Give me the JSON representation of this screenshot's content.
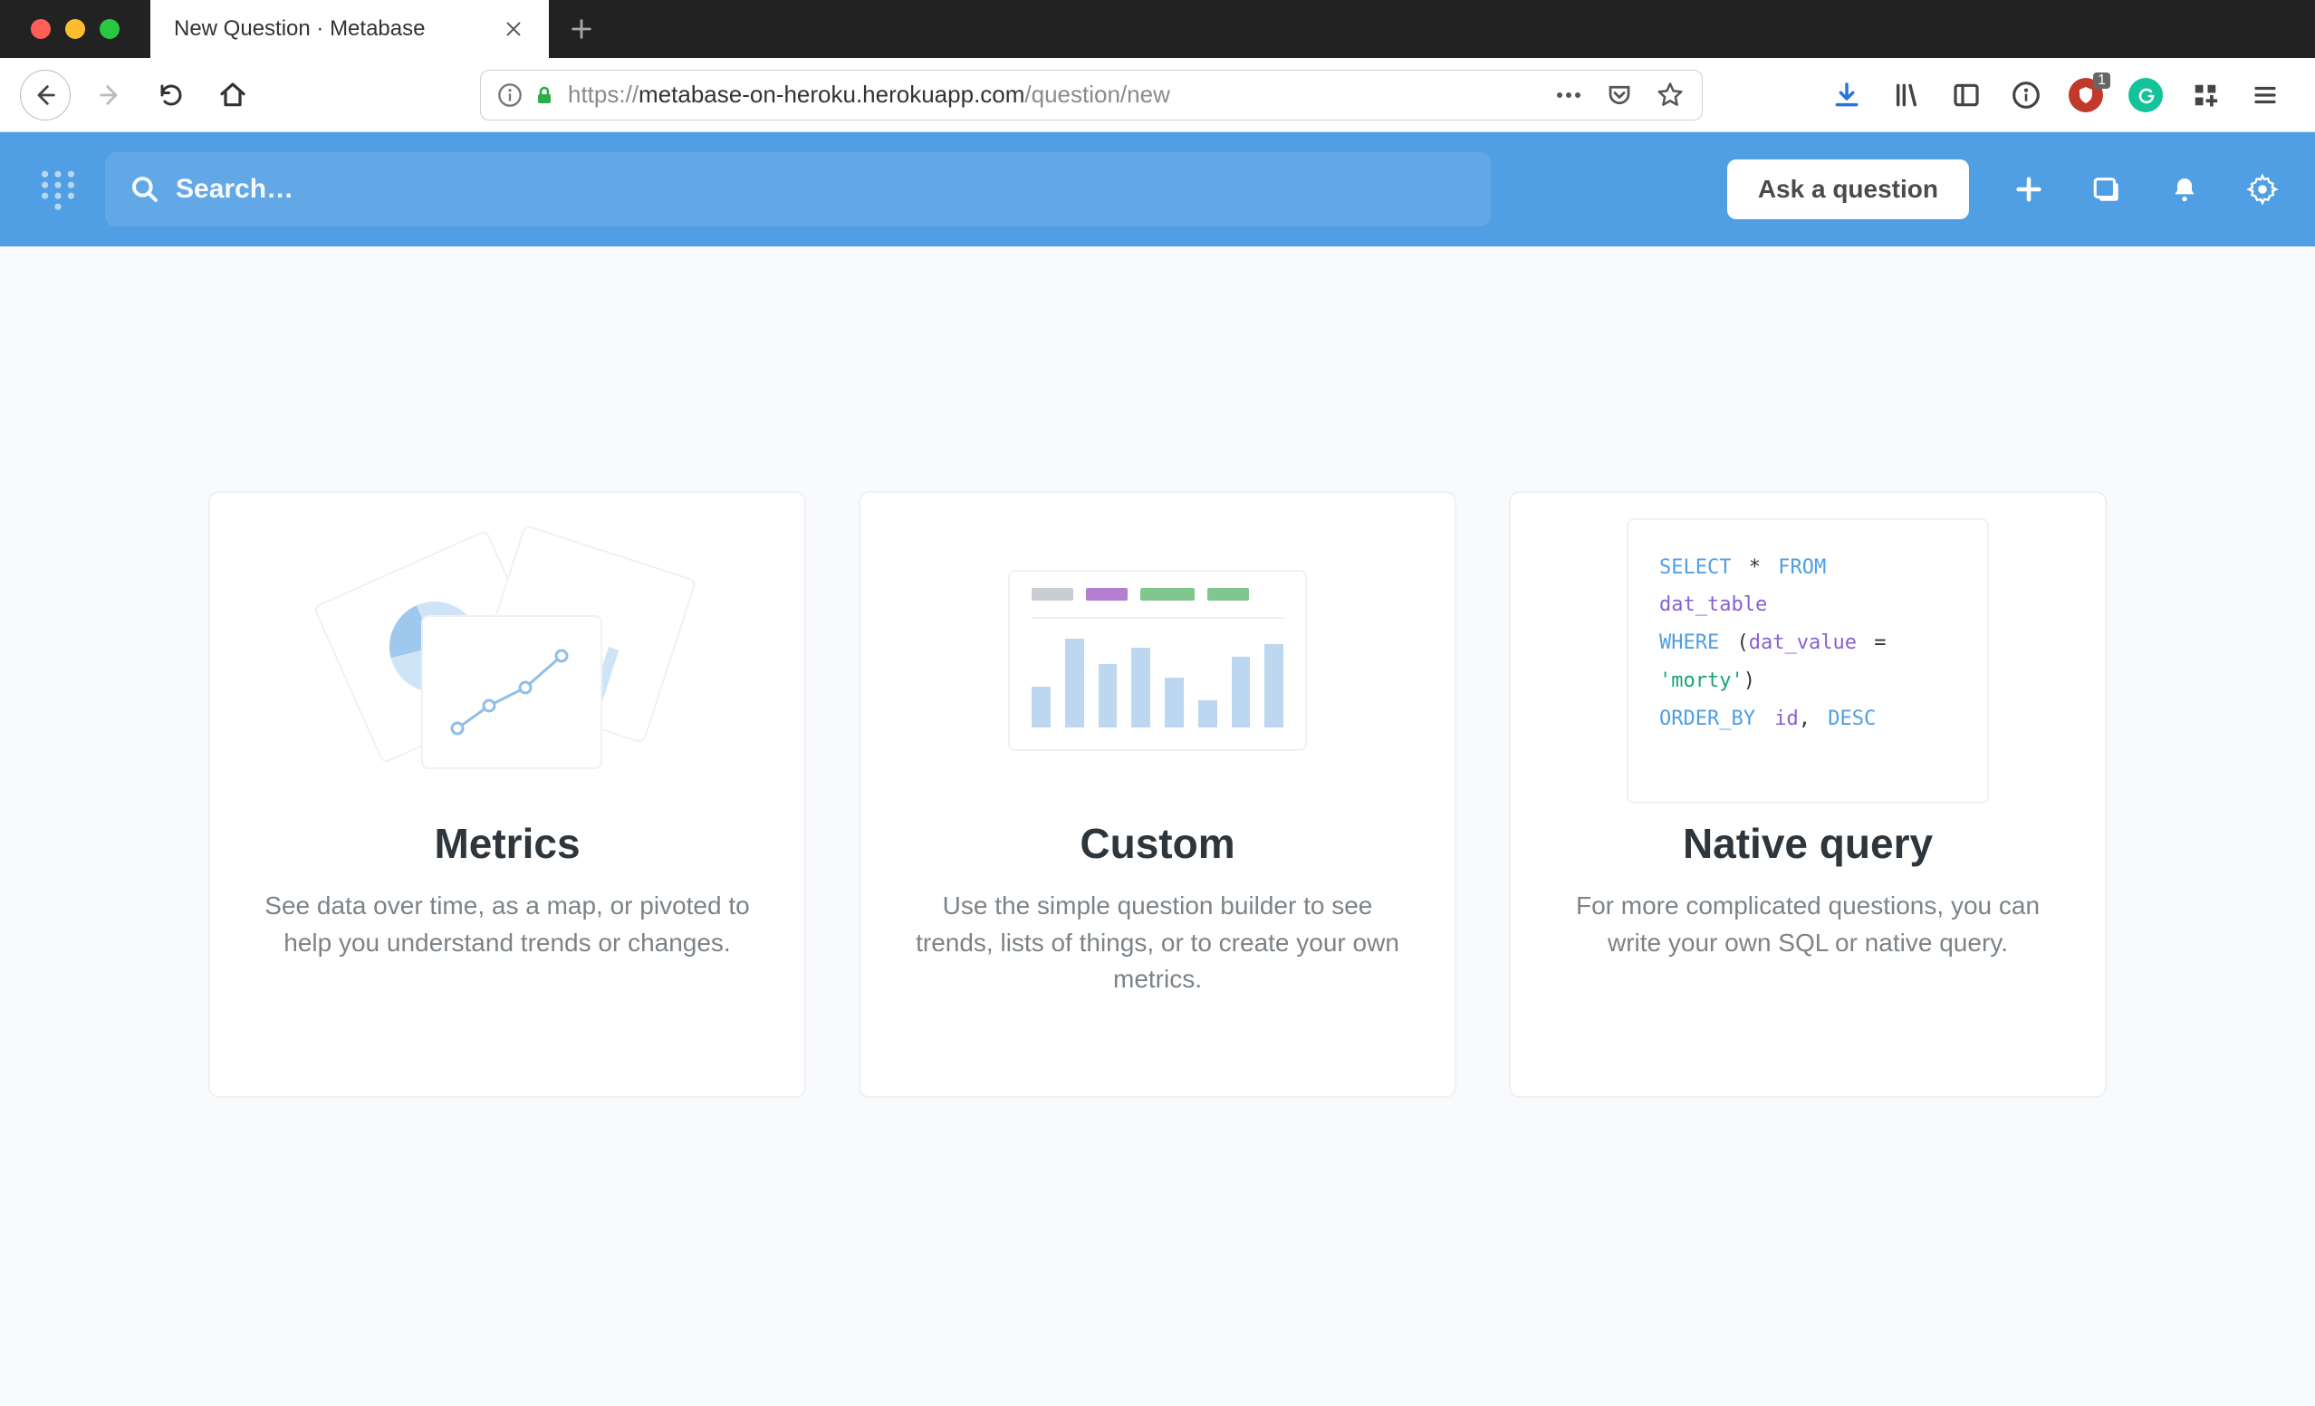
{
  "browser": {
    "tab_title": "New Question · Metabase",
    "url_scheme": "https://",
    "url_host": "metabase-on-heroku.herokuapp.com",
    "url_path": "/question/new",
    "ublock_badge": "1"
  },
  "header": {
    "search_placeholder": "Search…",
    "ask_button": "Ask a question"
  },
  "cards": {
    "metrics": {
      "title": "Metrics",
      "desc": "See data over time, as a map, or pivoted to help you understand trends or changes."
    },
    "custom": {
      "title": "Custom",
      "desc": "Use the simple question builder to see trends, lists of things, or to create your own metrics."
    },
    "native": {
      "title": "Native query",
      "desc": "For more complicated questions, you can write your own SQL or native query.",
      "sql": {
        "kw_select": "SELECT",
        "star": "*",
        "kw_from": "FROM",
        "tbl": "dat_table",
        "kw_where": "WHERE",
        "paren_open": "(",
        "col": "dat_value",
        "eq": "=",
        "val": "'morty'",
        "paren_close": ")",
        "kw_order": "ORDER_BY",
        "ord_col": "id",
        "comma": ",",
        "ord_dir": "DESC"
      }
    }
  },
  "chart_data": {
    "type": "bar",
    "note": "decorative illustration bars on the Custom card; heights are relative units, no axes/labels shown",
    "categories": [
      "b1",
      "b2",
      "b3",
      "b4",
      "b5",
      "b6",
      "b7",
      "b8"
    ],
    "values": [
      45,
      98,
      70,
      88,
      55,
      30,
      78,
      92
    ]
  }
}
